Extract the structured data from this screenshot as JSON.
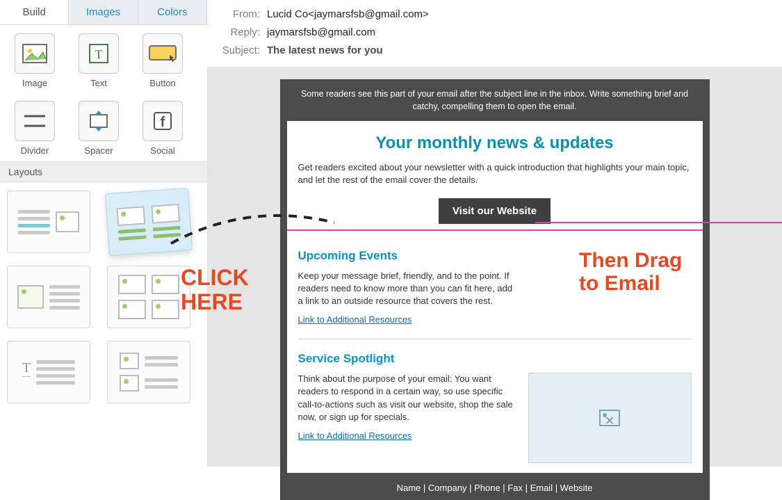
{
  "tabs": {
    "build": "Build",
    "images": "Images",
    "colors": "Colors"
  },
  "blocks": {
    "image": "Image",
    "text": "Text",
    "button": "Button",
    "divider": "Divider",
    "spacer": "Spacer",
    "social": "Social"
  },
  "layouts_header": "Layouts",
  "header": {
    "from_label": "From:",
    "from_value": "Lucid Co<jaymarsfsb@gmail.com>",
    "reply_label": "Reply:",
    "reply_value": "jaymarsfsb@gmail.com",
    "subject_label": "Subject:",
    "subject_value": "The latest news for you"
  },
  "email": {
    "preheader": "Some readers see this part of your email after the subject line in the inbox.\nWrite something brief and catchy, compelling them to open the email.",
    "title": "Your monthly news & updates",
    "intro": "Get readers excited about your newsletter with a quick introduction that highlights your main topic, and let the rest of the email cover the details.",
    "cta": "Visit our Website",
    "section1": {
      "title": "Upcoming Events",
      "body": "Keep your message brief, friendly, and to the point. If readers need to know more than you can fit here, add a link to an outside resource that covers the rest.",
      "link": "Link to Additional Resources"
    },
    "section2": {
      "title": "Service Spotlight",
      "body": "Think about the purpose of your email: You want readers to respond in a certain way, so use specific call-to-actions such as visit our website, shop the sale now, or sign up for specials.",
      "link": "Link to Additional Resources"
    },
    "footer": "Name | Company | Phone | Fax | Email | Website"
  },
  "annotations": {
    "click": "CLICK\nHERE",
    "drag": "Then Drag\nto Email"
  }
}
